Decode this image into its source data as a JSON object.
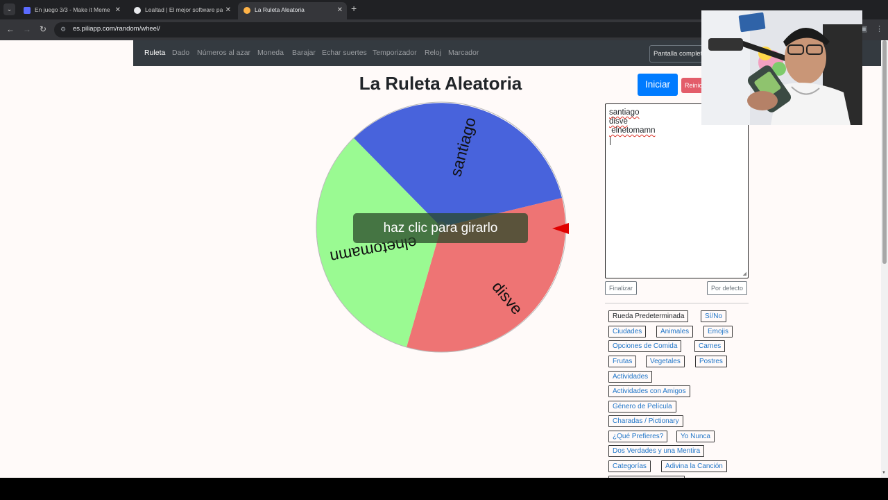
{
  "browser": {
    "tabs": [
      {
        "title": "En juego 3/3 - Make it Meme",
        "active": false
      },
      {
        "title": "Lealtad | El mejor software para",
        "active": false
      },
      {
        "title": "La Ruleta Aleatoria",
        "active": true
      }
    ],
    "address": "es.piliapp.com/random/wheel/"
  },
  "navbar": {
    "items": [
      "Ruleta",
      "Dado",
      "Números al azar",
      "Moneda",
      "Barajar",
      "Echar suertes",
      "Temporizador",
      "Reloj",
      "Marcador"
    ],
    "fullscreen_label": "Pantalla completa"
  },
  "page": {
    "title": "La Ruleta Aleatoria",
    "spin_hint": "haz clic para girarlo",
    "start_label": "Iniciar",
    "reset_label": "Reiniciar"
  },
  "wheel": {
    "segments": [
      {
        "label": "santiago",
        "color": "#4863dc"
      },
      {
        "label": "disve",
        "color": "#ee7474"
      },
      {
        "label": "elnetomamn",
        "color": "#9afa92"
      }
    ],
    "pointer_color": "#e00000"
  },
  "names_box": {
    "lines": [
      "santiago",
      "disve",
      " elnetomamn"
    ],
    "finish_label": "Finalizar",
    "default_label": "Por defecto"
  },
  "presets": [
    "Rueda Predeterminada",
    "Sí/No",
    "Ciudades",
    "Animales",
    "Emojis",
    "Opciones de Comida",
    "Carnes",
    "Frutas",
    "Vegetales",
    "Postres",
    "Actividades",
    "Actividades con Amigos",
    "Género de Película",
    "Charadas / Pictionary",
    "¿Qué Prefieres?",
    "Yo Nunca",
    "Dos Verdades y una Mentira",
    "Categorías",
    "Adivina la Canción"
  ],
  "webcam": {
    "description": "streamer webcam overlay"
  }
}
